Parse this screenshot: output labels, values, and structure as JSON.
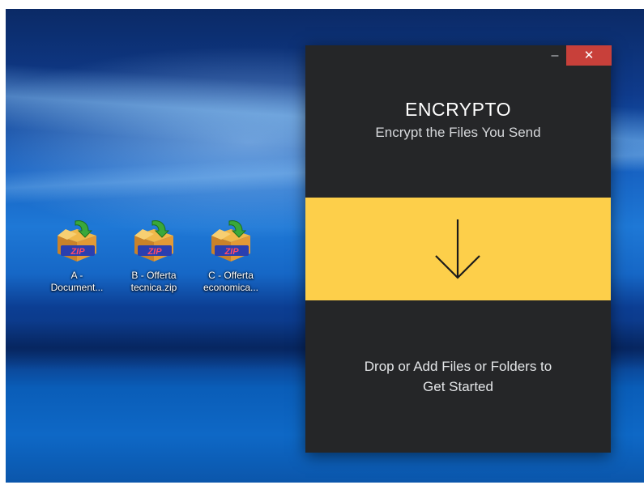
{
  "desktop": {
    "icons": [
      {
        "label": "A -\nDocument...",
        "icon": "zip-archive-icon"
      },
      {
        "label": "B - Offerta\ntecnica.zip",
        "icon": "zip-archive-icon"
      },
      {
        "label": "C - Offerta\neconomica...",
        "icon": "zip-archive-icon"
      }
    ]
  },
  "window": {
    "minimize_glyph": "–",
    "close_glyph": "✕",
    "title": "ENCRYPTO",
    "subtitle": "Encrypt the Files You Send",
    "drop_icon": "arrow-down-icon",
    "hint": "Drop or Add Files or Folders to\nGet Started"
  },
  "colors": {
    "window_bg": "#252628",
    "accent_yellow": "#fdcf4a",
    "close_red": "#c8403a"
  }
}
